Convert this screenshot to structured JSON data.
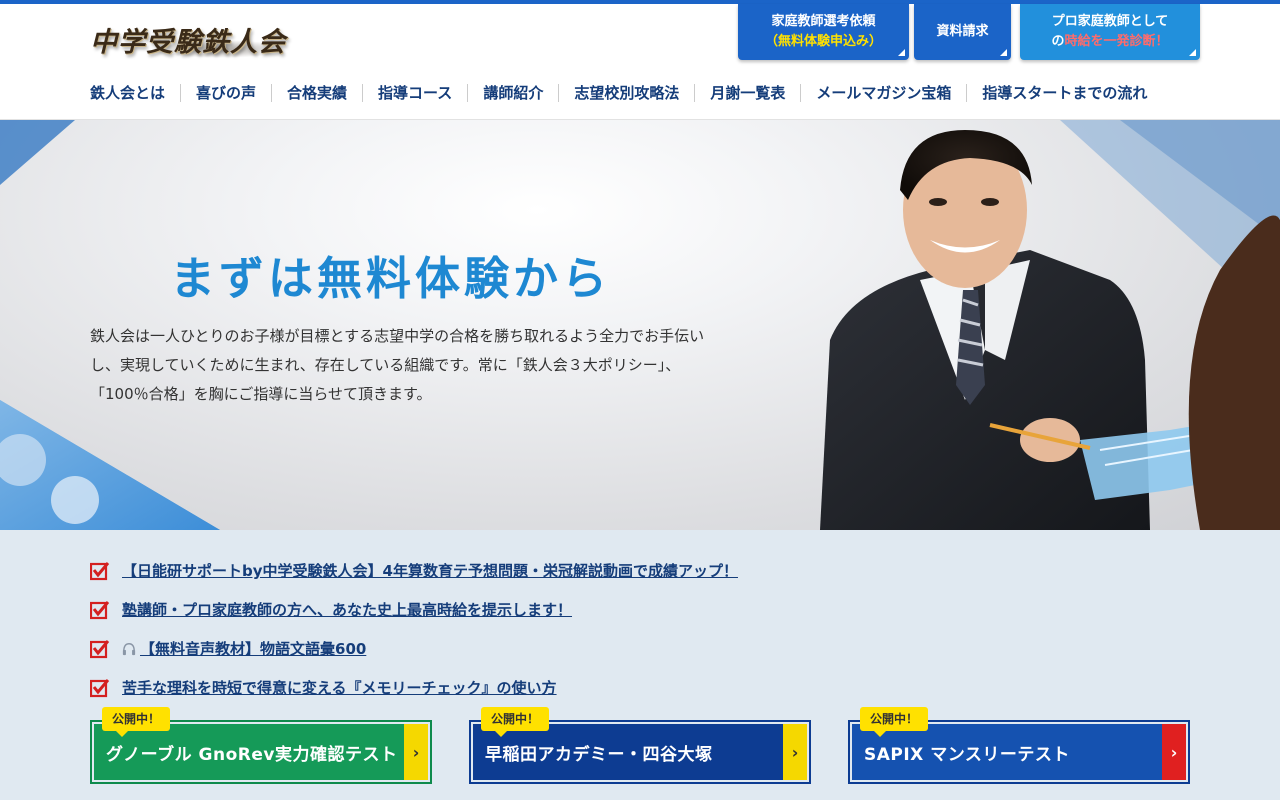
{
  "header": {
    "logo_text": "中学受験鉄人会",
    "buttons": [
      {
        "line1": "家庭教師選考依頼",
        "line2": "（無料体験申込み）"
      },
      {
        "line1": "資料請求"
      },
      {
        "line1": "プロ家庭教師として",
        "line2_prefix": "の",
        "line2_highlight": "時給を一発診断！"
      }
    ]
  },
  "nav": {
    "items": [
      "鉄人会とは",
      "喜びの声",
      "合格実績",
      "指導コース",
      "講師紹介",
      "志望校別攻略法",
      "月謝一覧表",
      "メールマガジン宝箱",
      "指導スタートまでの流れ"
    ]
  },
  "hero": {
    "title": "まずは無料体験から",
    "body": "鉄人会は一人ひとりのお子様が目標とする志望中学の合格を勝ち取れるよう全力でお手伝いし、実現していくために生まれ、存在している組織です。常に「鉄人会３大ポリシー」、「100％合格」を胸にご指導に当らせて頂きます。"
  },
  "news": {
    "items": [
      {
        "text": "【日能研サポートby中学受験鉄人会】4年算数育テ予想問題・栄冠解説動画で成績アップ！"
      },
      {
        "text": "塾講師・プロ家庭教師の方へ、あなた史上最高時給を提示します！"
      },
      {
        "text": "【無料音声教材】物語文語彙600",
        "icon": "headphones-icon"
      },
      {
        "text": "苦手な理科を時短で得意に変える『メモリーチェック』の使い方"
      }
    ]
  },
  "cards": [
    {
      "badge": "公開中！",
      "label": "グノーブル GnoRev実力確認テスト",
      "arrow": "›"
    },
    {
      "badge": "公開中！",
      "label": "早稲田アカデミー・四谷大塚",
      "arrow": "›"
    },
    {
      "badge": "公開中！",
      "label": "SAPIX マンスリーテスト",
      "arrow": "›"
    }
  ],
  "colors": {
    "accent": "#1b64c8",
    "light_accent": "#2290dc",
    "nav_text": "#153d7a",
    "highlight": "#ffe100",
    "green": "#159a58",
    "navy": "#0d3c92",
    "red": "#e02020"
  }
}
